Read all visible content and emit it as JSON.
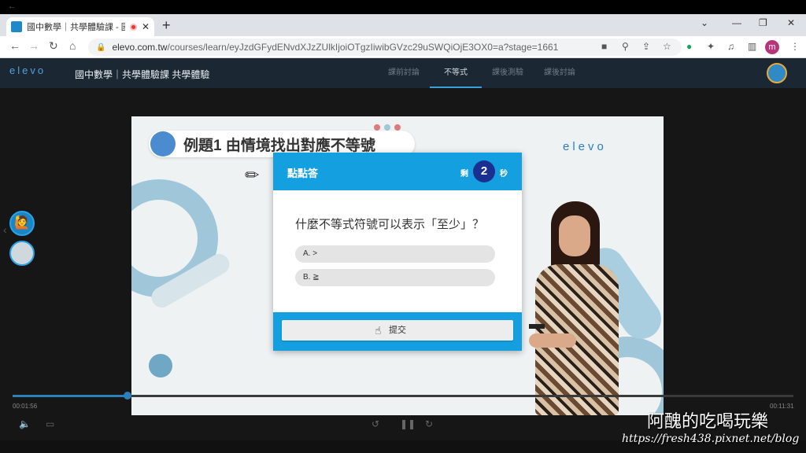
{
  "browser": {
    "tab_title": "國中數學｜共學體驗課 - 國中",
    "new_tab_symbol": "+",
    "url_host": "elevo.com.tw",
    "url_path": "/courses/learn/eyJzdGFydENvdXJzZUlkIjoiOTgzIiwibGVzc29uSWQiOjE3OX0=a?stage=1661",
    "profile_initial": "m"
  },
  "site": {
    "logo": "elevo",
    "course_title": "國中數學｜共學體驗課 共學體驗",
    "nav": [
      "課前討論",
      "不等式",
      "課後測驗",
      "課後討論"
    ],
    "active_nav": "不等式"
  },
  "video": {
    "example_title": "例題1 由情境找出對應不等號",
    "logo": "elevo"
  },
  "quiz": {
    "label": "點點答",
    "remain_label": "剩",
    "timer": "2",
    "sec_label": "秒",
    "question": "什麼不等式符號可以表示「至少」？",
    "options": [
      "A. >",
      "B. ≧"
    ],
    "submit": "提交"
  },
  "player": {
    "current_time": "00:01:56",
    "total_time": "00:11:31",
    "progress": 0.147
  },
  "watermark": {
    "line1": "阿醜的吃喝玩樂",
    "line2": "https://fresh438.pixnet.net/blog"
  },
  "colors": {
    "accent": "#14a0e0",
    "header_bg": "#1b2733",
    "timer_bg": "#1a2f8f"
  }
}
